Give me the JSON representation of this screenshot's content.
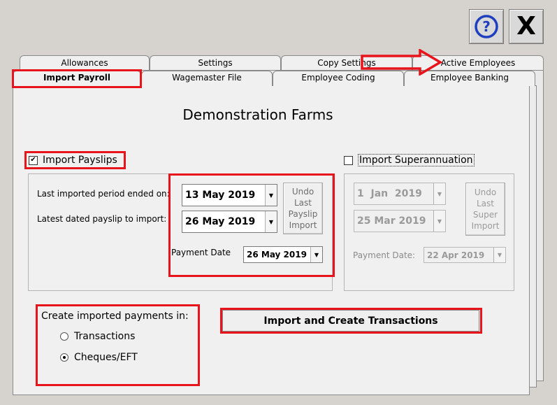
{
  "window": {
    "help_icon": "help-icon",
    "close_label": "X"
  },
  "tabs": {
    "back_row": [
      "Allowances",
      "Settings",
      "Copy Settings",
      "Active Employees"
    ],
    "front_row": [
      "Import Payroll",
      "Wagemaster File",
      "Employee Coding",
      "Employee Banking"
    ],
    "active": "Import Payroll"
  },
  "main": {
    "company_name": "Demonstration Farms",
    "payslips": {
      "checkbox_label": "Import Payslips",
      "checked": true,
      "last_imported_label": "Last imported period ended on:",
      "last_imported_value": "13 May 2019",
      "latest_payslip_label": "Latest dated payslip to import:",
      "latest_payslip_value": "26 May 2019",
      "undo_button": [
        "Undo",
        "Last",
        "Payslip",
        "Import"
      ],
      "payment_date_label": "Payment Date",
      "payment_date_value": "26 May 2019"
    },
    "super": {
      "checkbox_label": "Import Superannuation",
      "checked": false,
      "from_value": "1  Jan  2019",
      "to_value": "25 Mar 2019",
      "undo_button": [
        "Undo",
        "Last",
        "Super",
        "Import"
      ],
      "payment_date_label": "Payment Date:",
      "payment_date_value": "22 Apr 2019"
    },
    "payments": {
      "heading": "Create imported payments in:",
      "options": [
        "Transactions",
        "Cheques/EFT"
      ],
      "selected": "Cheques/EFT"
    },
    "import_button_label": "Import and Create Transactions"
  },
  "colors": {
    "highlight": "#e8141c",
    "help_icon": "#1f3fbf"
  }
}
